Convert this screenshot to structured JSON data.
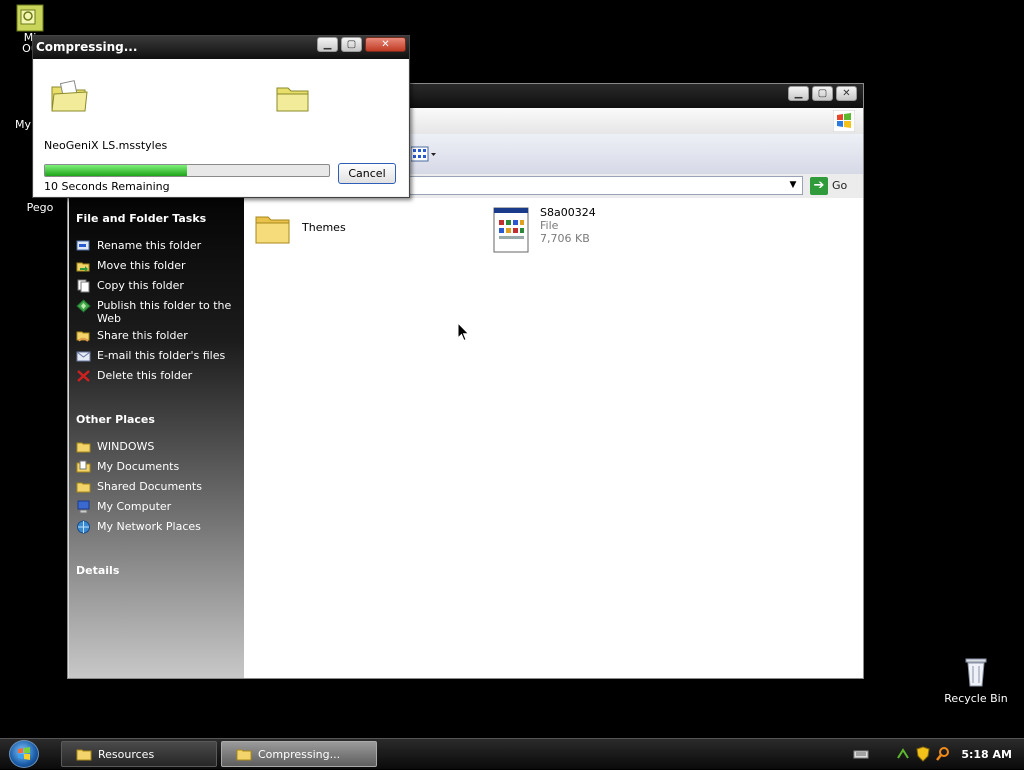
{
  "desktop": {
    "icons": [
      {
        "label": "Mi\nOu"
      },
      {
        "label": "My"
      },
      {
        "label": "Pego"
      },
      {
        "label": "Recycle Bin"
      }
    ]
  },
  "explorer": {
    "go_label": "Go",
    "task_pane": {
      "file_tasks": {
        "heading": "File and Folder Tasks",
        "items": [
          {
            "label": "Rename this folder",
            "icon": "rename-icon"
          },
          {
            "label": "Move this folder",
            "icon": "move-icon"
          },
          {
            "label": "Copy this folder",
            "icon": "copy-icon"
          },
          {
            "label": "Publish this folder to the Web",
            "icon": "publish-icon"
          },
          {
            "label": "Share this folder",
            "icon": "share-icon"
          },
          {
            "label": "E-mail this folder's files",
            "icon": "email-icon"
          },
          {
            "label": "Delete this folder",
            "icon": "delete-icon"
          }
        ]
      },
      "other_places": {
        "heading": "Other Places",
        "items": [
          {
            "label": "WINDOWS",
            "icon": "folder-icon"
          },
          {
            "label": "My Documents",
            "icon": "documents-icon"
          },
          {
            "label": "Shared Documents",
            "icon": "folder-icon"
          },
          {
            "label": "My Computer",
            "icon": "computer-icon"
          },
          {
            "label": "My Network Places",
            "icon": "network-icon"
          }
        ]
      },
      "details": {
        "heading": "Details"
      }
    },
    "files": [
      {
        "name": "Themes",
        "type": "folder"
      },
      {
        "name": "S8a00324",
        "kind": "File",
        "size": "7,706 KB"
      }
    ]
  },
  "dialog": {
    "title": "Compressing...",
    "filename": "NeoGeniX LS.msstyles",
    "remaining": "10 Seconds Remaining",
    "progress": 0.5,
    "cancel_label": "Cancel"
  },
  "taskbar": {
    "tasks": [
      {
        "label": "Resources",
        "active": false
      },
      {
        "label": "Compressing...",
        "active": true
      }
    ],
    "clock": "5:18 AM"
  },
  "colors": {
    "progress_fill": "#1fa319",
    "desktop_bg": "#000000"
  }
}
